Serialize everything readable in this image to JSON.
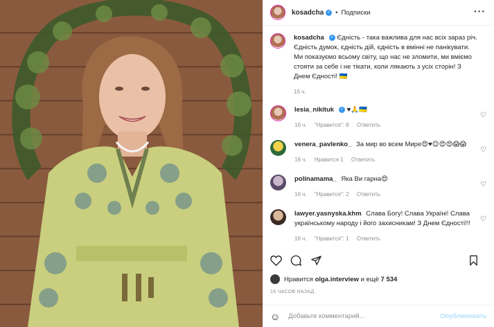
{
  "post": {
    "username": "kosadcha",
    "follow_label": "Подписки",
    "more_icon": "more-dots-icon",
    "caption": "Єдність - така важлива для нас всіх зараз річ. Єдність думок, єдність дій, єдність в вмінні не панікувати. Ми показуємо всьому світу, що нас не зломити, ми вміємо стояти за себе і не тікати, коли лякають з усіх сторін! З Днем Єдності! 🇺🇦",
    "caption_time": "16 ч."
  },
  "comments": [
    {
      "username": "lesia_nikituk",
      "verified": true,
      "text": "♥🙏🇺🇦",
      "time": "16 ч.",
      "likes": "\"Нравится\": 8",
      "reply": "Ответить"
    },
    {
      "username": "venera_pavlenko_",
      "verified": false,
      "text": "За мир во всем Мире😍♥😊😍😍😱😱",
      "time": "16 ч.",
      "likes": "Нравится 1",
      "reply": "Ответить"
    },
    {
      "username": "polinamama_",
      "verified": false,
      "text": "Яка Ви гарна😍",
      "time": "16 ч.",
      "likes": "\"Нравится\": 2",
      "reply": "Ответить"
    },
    {
      "username": "lawyer.yasnyska.khm",
      "verified": false,
      "text": "Слава Богу! Слава Україні! Слава українському народу і його захисникам! З Днем Єдності!!!",
      "time": "16 ч.",
      "likes": "\"Нравится\": 1",
      "reply": "Ответить"
    }
  ],
  "actions": {
    "like_icon": "heart-icon",
    "comment_icon": "comment-icon",
    "share_icon": "share-icon",
    "save_icon": "bookmark-icon"
  },
  "likes": {
    "prefix": "Нравится",
    "user": "olga.interview",
    "middle": "и ещё",
    "count": "7 534"
  },
  "posted_ago": "16 ЧАСОВ НАЗАД",
  "composer": {
    "placeholder": "Добавьте комментарий...",
    "publish": "Опубликовать"
  },
  "colors": {
    "accent": "#3897f0",
    "publish_disabled": "#b2dffc",
    "muted": "#8e8e8e"
  }
}
